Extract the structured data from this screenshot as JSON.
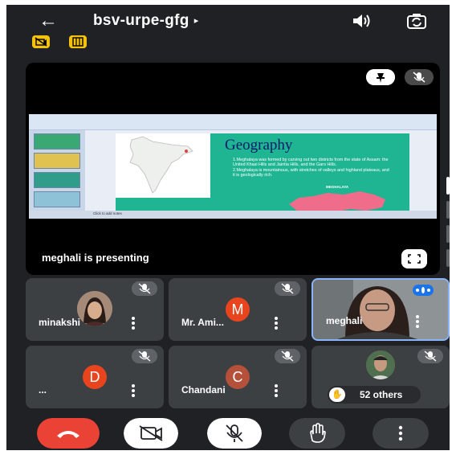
{
  "meeting": {
    "back_icon": "arrow-left-icon",
    "code": "bsv-urpe-gfg",
    "caret": "▸",
    "speaker_icon": "speaker-icon",
    "flip_icon": "camera-flip-icon"
  },
  "badges": [
    {
      "icon": "no-recording-icon",
      "color": "#f4c20d"
    },
    {
      "icon": "captions-box-icon",
      "color": "#f4c20d"
    }
  ],
  "presentation": {
    "presenting_label": "meghali is presenting",
    "pin_icon": "pin-icon",
    "mute_icon": "mic-off-icon",
    "fullscreen_icon": "fullscreen-icon",
    "slide": {
      "heading": "Geography",
      "bullets": [
        "1.Meghalaya was formed by carving out two districts from the state of Assam: the United Khasi Hills and Jaintia Hills, and the Garo Hills.",
        "2.Meghalaya is mountainous, with stretches of valleys and highland plateaus, and it is geologically rich."
      ],
      "map_label": "MEGHALAYA",
      "notes_placeholder": "Click to add notes"
    }
  },
  "participants": [
    {
      "name": "minakshi",
      "avatar": "photo",
      "muted": true
    },
    {
      "name": "Mr. Ami...",
      "avatar": "M",
      "avatar_color": "#e8451f",
      "muted": true
    },
    {
      "name": "meghali",
      "avatar": "photo",
      "muted": false,
      "speaking": true
    },
    {
      "name": "...",
      "avatar": "D",
      "avatar_color": "#e8451f",
      "muted": true
    },
    {
      "name": "Chandani",
      "avatar": "C",
      "avatar_color": "#b5513a",
      "muted": true
    },
    {
      "name": "52 others",
      "avatar": "photo",
      "muted": true
    }
  ],
  "toolbar": [
    {
      "name": "end-call-button",
      "icon": "phone-hangup-icon",
      "color": "#ea4335"
    },
    {
      "name": "camera-button",
      "icon": "camera-off-icon",
      "color": "#ffffff"
    },
    {
      "name": "microphone-button",
      "icon": "mic-off-icon",
      "color": "#ffffff"
    },
    {
      "name": "raise-hand-button",
      "icon": "hand-icon",
      "color": "#3c4043"
    },
    {
      "name": "more-options-button",
      "icon": "more-vertical-icon",
      "color": "#3c4043"
    }
  ],
  "colors": {
    "background": "#202124",
    "tile": "#3c4043",
    "accent": "#8ab4f8",
    "danger": "#ea4335"
  }
}
